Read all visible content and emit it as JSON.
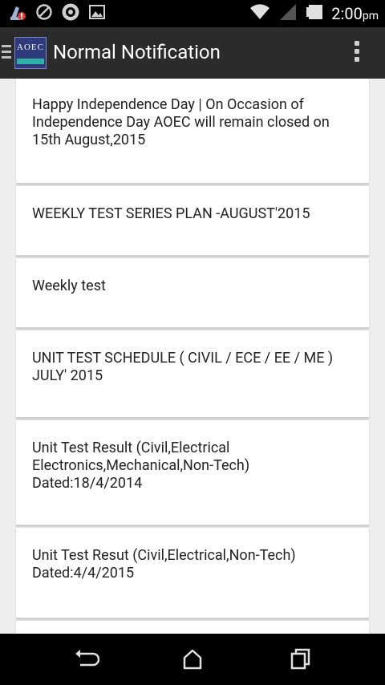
{
  "status_bar": {
    "time": "2:00",
    "ampm": "pm",
    "left_icons": [
      "cleaner-icon",
      "no-sync-icon",
      "circle-app-icon",
      "image-icon"
    ],
    "right_icons": [
      "wifi-icon",
      "signal-icon",
      "battery-icon"
    ]
  },
  "action_bar": {
    "logo_text": "AOEC",
    "logo_subtext": "ENGINEERING",
    "title": "Normal Notification"
  },
  "notifications": [
    {
      "text": "Happy Independence Day | On Occasion of Independence Day AOEC will remain closed on 15th August,2015"
    },
    {
      "text": "WEEKLY TEST SERIES PLAN -AUGUST'2015"
    },
    {
      "text": "Weekly test"
    },
    {
      "text": "UNIT TEST SCHEDULE ( CIVIL / ECE / EE / ME ) JULY' 2015"
    },
    {
      "text": "Unit Test Result (Civil,Electrical Electronics,Mechanical,Non-Tech) Dated:18/4/2014"
    },
    {
      "text": "Unit Test Resut (Civil,Electrical,Non-Tech) Dated:4/4/2015"
    }
  ],
  "nav_bar": {
    "buttons": [
      "back-icon",
      "home-icon",
      "recents-icon"
    ]
  }
}
